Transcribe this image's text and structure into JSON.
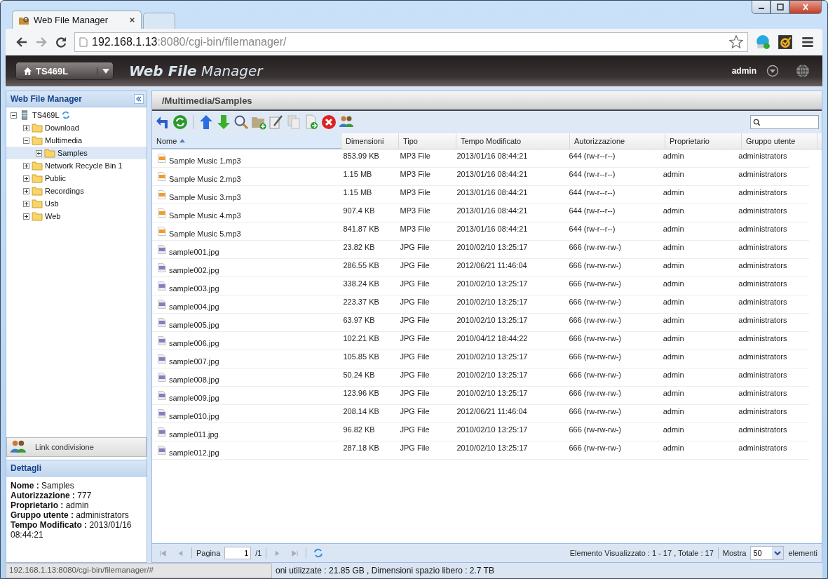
{
  "browser": {
    "tabs": [
      {
        "title": "Web File Manager",
        "selected": true
      },
      {
        "selected": false
      }
    ],
    "url_host": "192.168.1.13",
    "url_rest": ":8080/cgi-bin/filemanager/"
  },
  "header": {
    "device": "TS469L",
    "title_bold": "Web File",
    "title_rest": "Manager",
    "user": "admin"
  },
  "sidebar": {
    "title": "Web File Manager",
    "tree": [
      {
        "label": "TS469L",
        "kind": "server",
        "expanded": true,
        "selected": false,
        "children": [
          {
            "label": "Download",
            "kind": "folder",
            "expanded": false,
            "selected": false
          },
          {
            "label": "Multimedia",
            "kind": "folder",
            "expanded": true,
            "selected": false,
            "children": [
              {
                "label": "Samples",
                "kind": "folder",
                "expanded": false,
                "selected": true
              }
            ]
          },
          {
            "label": "Network Recycle Bin 1",
            "kind": "folder",
            "expanded": false,
            "selected": false
          },
          {
            "label": "Public",
            "kind": "folder",
            "expanded": false,
            "selected": false
          },
          {
            "label": "Recordings",
            "kind": "folder",
            "expanded": false,
            "selected": false
          },
          {
            "label": "Usb",
            "kind": "folder",
            "expanded": false,
            "selected": false
          },
          {
            "label": "Web",
            "kind": "folder",
            "expanded": false,
            "selected": false
          }
        ]
      }
    ],
    "share_button": "Link condivisione"
  },
  "details": {
    "title": "Dettagli",
    "fields": [
      {
        "label": "Nome :",
        "value": "Samples"
      },
      {
        "label": "Autorizzazione :",
        "value": "777"
      },
      {
        "label": "Proprietario :",
        "value": "admin"
      },
      {
        "label": "Gruppo utente :",
        "value": "administrators"
      },
      {
        "label": "Tempo Modificato :",
        "value": "2013/01/16 08:44:21"
      }
    ]
  },
  "path": "/Multimedia/Samples",
  "table": {
    "columns": [
      {
        "label": "Nome",
        "sorted": true
      },
      {
        "label": "Dimensioni",
        "sorted": false
      },
      {
        "label": "Tipo",
        "sorted": false
      },
      {
        "label": "Tempo Modificato",
        "sorted": false
      },
      {
        "label": "Autorizzazione",
        "sorted": false
      },
      {
        "label": "Proprietario",
        "sorted": false
      },
      {
        "label": "Gruppo utente",
        "sorted": false
      }
    ],
    "rows": [
      {
        "kind": "mp3",
        "cells": [
          "Sample Music 1.mp3",
          "853.99 KB",
          "MP3 File",
          "2013/01/16 08:44:21",
          "644 (rw-r--r--)",
          "admin",
          "administrators"
        ]
      },
      {
        "kind": "mp3",
        "cells": [
          "Sample Music 2.mp3",
          "1.15 MB",
          "MP3 File",
          "2013/01/16 08:44:21",
          "644 (rw-r--r--)",
          "admin",
          "administrators"
        ]
      },
      {
        "kind": "mp3",
        "cells": [
          "Sample Music 3.mp3",
          "1.15 MB",
          "MP3 File",
          "2013/01/16 08:44:21",
          "644 (rw-r--r--)",
          "admin",
          "administrators"
        ]
      },
      {
        "kind": "mp3",
        "cells": [
          "Sample Music 4.mp3",
          "907.4 KB",
          "MP3 File",
          "2013/01/16 08:44:21",
          "644 (rw-r--r--)",
          "admin",
          "administrators"
        ]
      },
      {
        "kind": "mp3",
        "cells": [
          "Sample Music 5.mp3",
          "841.87 KB",
          "MP3 File",
          "2013/01/16 08:44:21",
          "644 (rw-r--r--)",
          "admin",
          "administrators"
        ]
      },
      {
        "kind": "jpg",
        "cells": [
          "sample001.jpg",
          "23.82 KB",
          "JPG File",
          "2010/02/10 13:25:17",
          "666 (rw-rw-rw-)",
          "admin",
          "administrators"
        ]
      },
      {
        "kind": "jpg",
        "cells": [
          "sample002.jpg",
          "286.55 KB",
          "JPG File",
          "2012/06/21 11:46:04",
          "666 (rw-rw-rw-)",
          "admin",
          "administrators"
        ]
      },
      {
        "kind": "jpg",
        "cells": [
          "sample003.jpg",
          "338.24 KB",
          "JPG File",
          "2010/02/10 13:25:17",
          "666 (rw-rw-rw-)",
          "admin",
          "administrators"
        ]
      },
      {
        "kind": "jpg",
        "cells": [
          "sample004.jpg",
          "223.37 KB",
          "JPG File",
          "2010/02/10 13:25:17",
          "666 (rw-rw-rw-)",
          "admin",
          "administrators"
        ]
      },
      {
        "kind": "jpg",
        "cells": [
          "sample005.jpg",
          "63.97 KB",
          "JPG File",
          "2010/02/10 13:25:17",
          "666 (rw-rw-rw-)",
          "admin",
          "administrators"
        ]
      },
      {
        "kind": "jpg",
        "cells": [
          "sample006.jpg",
          "102.21 KB",
          "JPG File",
          "2010/04/12 18:44:22",
          "666 (rw-rw-rw-)",
          "admin",
          "administrators"
        ]
      },
      {
        "kind": "jpg",
        "cells": [
          "sample007.jpg",
          "105.85 KB",
          "JPG File",
          "2010/02/10 13:25:17",
          "666 (rw-rw-rw-)",
          "admin",
          "administrators"
        ]
      },
      {
        "kind": "jpg",
        "cells": [
          "sample008.jpg",
          "50.24 KB",
          "JPG File",
          "2010/02/10 13:25:17",
          "666 (rw-rw-rw-)",
          "admin",
          "administrators"
        ]
      },
      {
        "kind": "jpg",
        "cells": [
          "sample009.jpg",
          "123.96 KB",
          "JPG File",
          "2010/02/10 13:25:17",
          "666 (rw-rw-rw-)",
          "admin",
          "administrators"
        ]
      },
      {
        "kind": "jpg",
        "cells": [
          "sample010.jpg",
          "208.14 KB",
          "JPG File",
          "2012/06/21 11:46:04",
          "666 (rw-rw-rw-)",
          "admin",
          "administrators"
        ]
      },
      {
        "kind": "jpg",
        "cells": [
          "sample011.jpg",
          "96.82 KB",
          "JPG File",
          "2010/02/10 13:25:17",
          "666 (rw-rw-rw-)",
          "admin",
          "administrators"
        ]
      },
      {
        "kind": "jpg",
        "cells": [
          "sample012.jpg",
          "287.18 KB",
          "JPG File",
          "2010/02/10 13:25:17",
          "666 (rw-rw-rw-)",
          "admin",
          "administrators"
        ]
      }
    ]
  },
  "pager": {
    "label": "Pagina",
    "page": "1",
    "of": "/1",
    "summary": "Elemento Visualizzato : 1 - 17 , Totale : 17",
    "show_label": "Mostra",
    "page_size": "50",
    "unit": "elementi"
  },
  "status": {
    "link_preview": "192.168.1.13:8080/cgi-bin/filemanager/#",
    "storage": "oni utilizzate : 21.85 GB , Dimensioni spazio libero : 2.7 TB"
  }
}
